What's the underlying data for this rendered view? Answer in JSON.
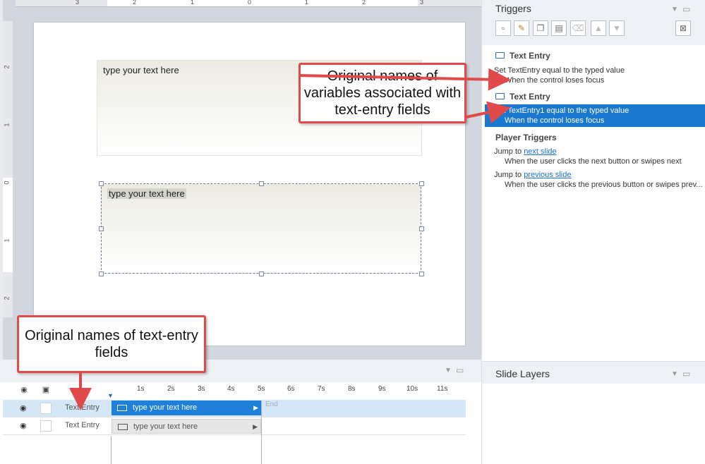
{
  "slide": {
    "ruler_numbers_h": [
      "3",
      "2",
      "1",
      "0",
      "1",
      "2",
      "3"
    ],
    "ruler_numbers_v": [
      "2",
      "1",
      "0",
      "1",
      "2"
    ],
    "textbox1": {
      "placeholder": "type your text here"
    },
    "textbox2": {
      "placeholder": "type your text here"
    }
  },
  "triggers_panel": {
    "title": "Triggers",
    "toolbar_icons": [
      "new-trigger-icon",
      "edit-trigger-icon",
      "copy-icon",
      "paste-icon",
      "delete-icon",
      "move-up-icon",
      "move-down-icon",
      "variables-icon"
    ],
    "groups": [
      {
        "name": "Text Entry",
        "action": "Set TextEntry equal to the typed value",
        "condition": "When the control loses focus",
        "selected": false
      },
      {
        "name": "Text Entry",
        "action": "Set TextEntry1 equal to the typed value",
        "condition": "When the control loses focus",
        "selected": true
      }
    ],
    "player_triggers": {
      "title": "Player Triggers",
      "items": [
        {
          "prefix": "Jump to ",
          "link": "next slide",
          "condition": "When the user clicks the next button or swipes next"
        },
        {
          "prefix": "Jump to ",
          "link": "previous slide",
          "condition": "When the user clicks the previous button or swipes prev..."
        }
      ]
    },
    "selection_color": "#1b78cf"
  },
  "layers_panel": {
    "title": "Slide Layers"
  },
  "timeline": {
    "seconds": [
      "1s",
      "2s",
      "3s",
      "4s",
      "5s",
      "6s",
      "7s",
      "8s",
      "9s",
      "10s",
      "11s"
    ],
    "rows": [
      {
        "name": "Text Entry",
        "bar_label": "type your text here",
        "selected": true
      },
      {
        "name": "Text Entry",
        "bar_label": "type your text here",
        "selected": false
      }
    ],
    "end_label": "End"
  },
  "callouts": {
    "variables": "Original names of variables associated with text-entry fields",
    "fields": "Original names of text-entry fields"
  }
}
